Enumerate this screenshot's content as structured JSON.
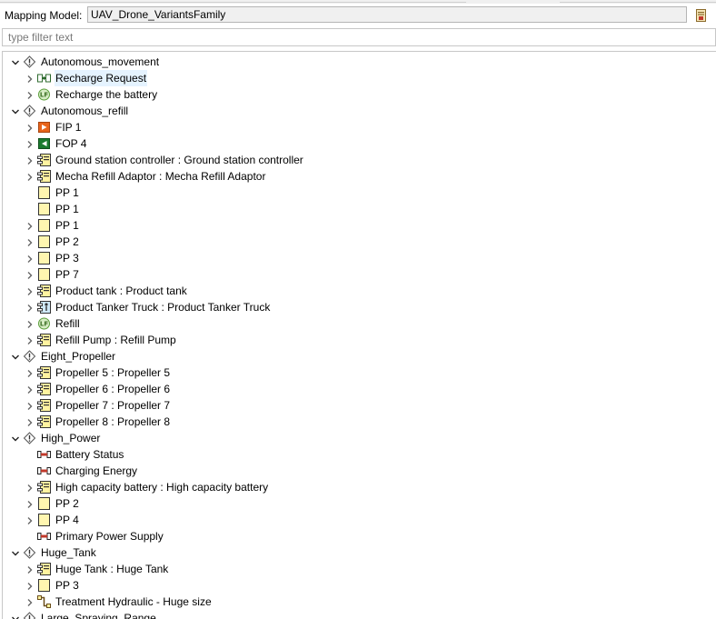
{
  "header": {
    "mapping_label": "Mapping Model:",
    "mapping_value": "UAV_Drone_VariantsFamily"
  },
  "filter": {
    "placeholder": "type filter text"
  },
  "tree": [
    {
      "label": "Autonomous_movement",
      "icon": "feature-icon",
      "level": 0,
      "toggle": "expanded"
    },
    {
      "label": "Recharge Request",
      "icon": "functional-exchange-icon",
      "level": 1,
      "toggle": "collapsed",
      "selected": true
    },
    {
      "label": "Recharge the battery",
      "icon": "logical-function-icon",
      "level": 1,
      "toggle": "collapsed"
    },
    {
      "label": "Autonomous_refill",
      "icon": "feature-icon",
      "level": 0,
      "toggle": "expanded"
    },
    {
      "label": "FIP 1",
      "icon": "input-port-icon",
      "level": 1,
      "toggle": "collapsed"
    },
    {
      "label": "FOP 4",
      "icon": "output-port-icon",
      "level": 1,
      "toggle": "collapsed"
    },
    {
      "label": "Ground station controller : Ground station controller",
      "icon": "component-part-icon",
      "level": 1,
      "toggle": "collapsed"
    },
    {
      "label": "Mecha Refill Adaptor : Mecha Refill Adaptor",
      "icon": "component-part-icon",
      "level": 1,
      "toggle": "collapsed"
    },
    {
      "label": "PP 1",
      "icon": "physical-port-icon",
      "level": 1,
      "toggle": "none"
    },
    {
      "label": "PP 1",
      "icon": "physical-port-icon",
      "level": 1,
      "toggle": "none"
    },
    {
      "label": "PP 1",
      "icon": "physical-port-icon",
      "level": 1,
      "toggle": "collapsed"
    },
    {
      "label": "PP 2",
      "icon": "physical-port-icon",
      "level": 1,
      "toggle": "collapsed"
    },
    {
      "label": "PP 3",
      "icon": "physical-port-icon",
      "level": 1,
      "toggle": "collapsed"
    },
    {
      "label": "PP 7",
      "icon": "physical-port-icon",
      "level": 1,
      "toggle": "collapsed"
    },
    {
      "label": "Product tank : Product tank",
      "icon": "component-part-icon",
      "level": 1,
      "toggle": "collapsed"
    },
    {
      "label": "Product Tanker Truck : Product Tanker Truck",
      "icon": "actor-part-icon",
      "level": 1,
      "toggle": "collapsed"
    },
    {
      "label": "Refill",
      "icon": "logical-function-icon",
      "level": 1,
      "toggle": "collapsed"
    },
    {
      "label": "Refill Pump : Refill Pump",
      "icon": "component-part-icon",
      "level": 1,
      "toggle": "collapsed"
    },
    {
      "label": "Eight_Propeller",
      "icon": "feature-icon",
      "level": 0,
      "toggle": "expanded"
    },
    {
      "label": "Propeller 5 : Propeller 5",
      "icon": "component-part-icon",
      "level": 1,
      "toggle": "collapsed"
    },
    {
      "label": "Propeller 6 : Propeller 6",
      "icon": "component-part-icon",
      "level": 1,
      "toggle": "collapsed"
    },
    {
      "label": "Propeller 7 : Propeller 7",
      "icon": "component-part-icon",
      "level": 1,
      "toggle": "collapsed"
    },
    {
      "label": "Propeller 8 : Propeller 8",
      "icon": "component-part-icon",
      "level": 1,
      "toggle": "collapsed"
    },
    {
      "label": "High_Power",
      "icon": "feature-icon",
      "level": 0,
      "toggle": "expanded"
    },
    {
      "label": "Battery Status",
      "icon": "exchange-item-icon",
      "level": 1,
      "toggle": "none"
    },
    {
      "label": "Charging Energy",
      "icon": "exchange-item-icon",
      "level": 1,
      "toggle": "none"
    },
    {
      "label": "High capacity battery : High capacity battery",
      "icon": "component-part-icon",
      "level": 1,
      "toggle": "collapsed"
    },
    {
      "label": "PP 2",
      "icon": "physical-port-icon",
      "level": 1,
      "toggle": "collapsed"
    },
    {
      "label": "PP 4",
      "icon": "physical-port-icon",
      "level": 1,
      "toggle": "collapsed"
    },
    {
      "label": "Primary Power Supply",
      "icon": "exchange-item-icon",
      "level": 1,
      "toggle": "none"
    },
    {
      "label": "Huge_Tank",
      "icon": "feature-icon",
      "level": 0,
      "toggle": "expanded"
    },
    {
      "label": "Huge Tank : Huge Tank",
      "icon": "component-part-icon",
      "level": 1,
      "toggle": "collapsed"
    },
    {
      "label": "PP 3",
      "icon": "physical-port-icon",
      "level": 1,
      "toggle": "collapsed"
    },
    {
      "label": "Treatment Hydraulic - Huge size",
      "icon": "physical-link-icon",
      "level": 1,
      "toggle": "collapsed"
    },
    {
      "label": "Large_Spraying_Range",
      "icon": "feature-icon",
      "level": 0,
      "toggle": "expanded"
    }
  ],
  "colors": {
    "selection": "#e5f3ff",
    "component_fill": "#fff3a0",
    "port_fill": "#fff6b0",
    "input_port": "#e8641b",
    "output_port": "#1a7a2e",
    "function_green": "#5a9e3a",
    "exchange_red": "#c0392b"
  }
}
